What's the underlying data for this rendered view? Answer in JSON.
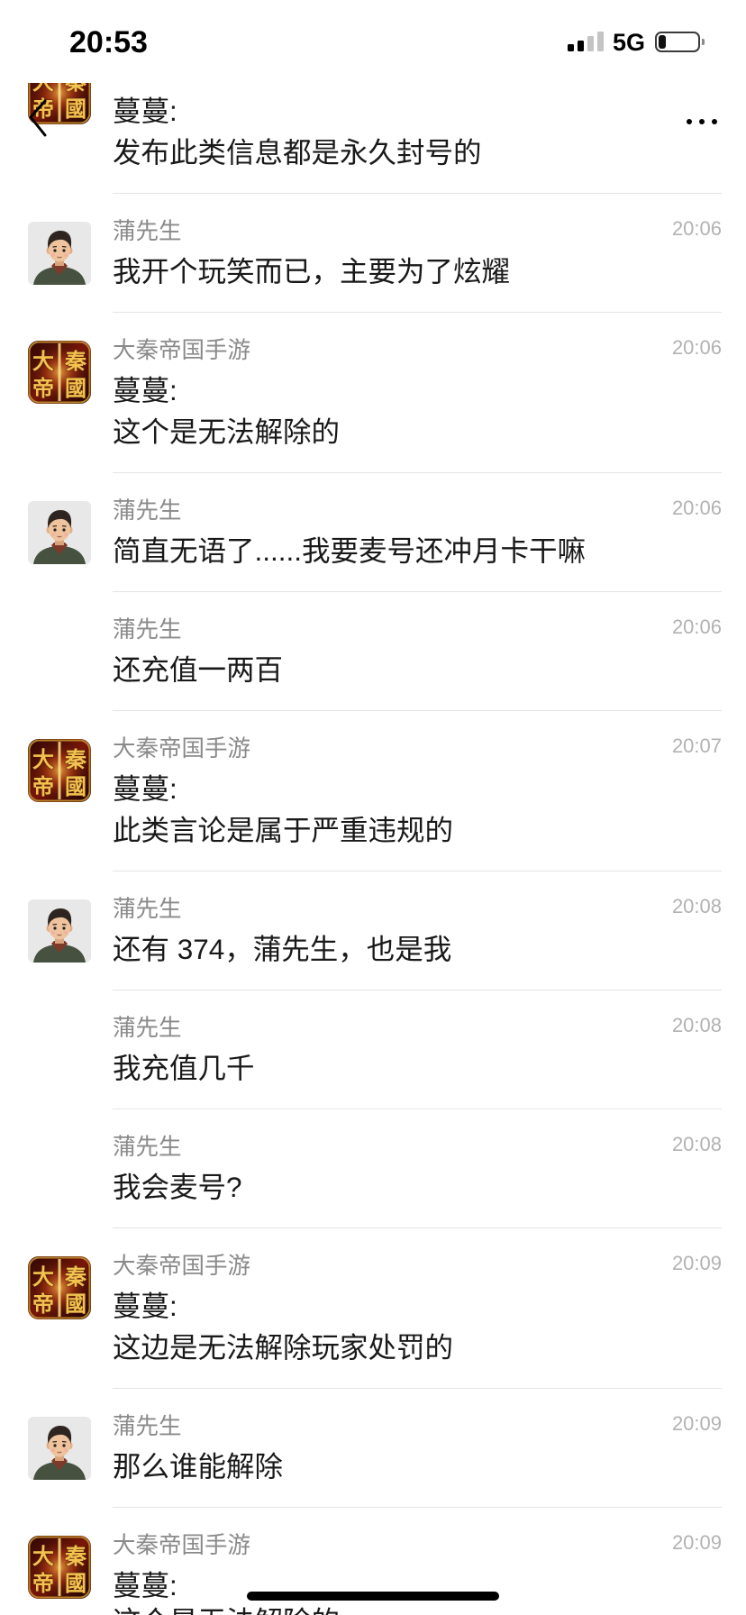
{
  "status_bar": {
    "time": "20:53",
    "network": "5G",
    "signal_bars_filled": 2,
    "signal_bars_total": 4,
    "battery_level": 0.2
  },
  "nav": {
    "back_icon": "chevron-left-icon",
    "more_icon": "more-dots-icon"
  },
  "game_avatar": {
    "logo_chars": [
      "大",
      "秦",
      "帝",
      "國"
    ]
  },
  "messages": [
    {
      "avatar": "game-app-icon",
      "lines": [
        "蔓蔓:",
        "发布此类信息都是永久封号的"
      ]
    },
    {
      "sender": "蒲先生",
      "time": "20:06",
      "avatar": "user-cartoon-icon",
      "lines": [
        "我开个玩笑而已，主要为了炫耀"
      ]
    },
    {
      "sender": "大秦帝国手游",
      "time": "20:06",
      "avatar": "game-app-icon",
      "lines": [
        "蔓蔓:",
        "这个是无法解除的"
      ]
    },
    {
      "sender": "蒲先生",
      "time": "20:06",
      "avatar": "user-cartoon-icon",
      "lines": [
        "简直无语了......我要麦号还冲月卡干嘛"
      ]
    },
    {
      "sender": "蒲先生",
      "time": "20:06",
      "lines": [
        "还充值一两百"
      ]
    },
    {
      "sender": "大秦帝国手游",
      "time": "20:07",
      "avatar": "game-app-icon",
      "lines": [
        "蔓蔓:",
        "此类言论是属于严重违规的"
      ]
    },
    {
      "sender": "蒲先生",
      "time": "20:08",
      "avatar": "user-cartoon-icon",
      "lines": [
        "还有 374，蒲先生，也是我"
      ]
    },
    {
      "sender": "蒲先生",
      "time": "20:08",
      "lines": [
        "我充值几千"
      ]
    },
    {
      "sender": "蒲先生",
      "time": "20:08",
      "lines": [
        "我会麦号?"
      ]
    },
    {
      "sender": "大秦帝国手游",
      "time": "20:09",
      "avatar": "game-app-icon",
      "lines": [
        "蔓蔓:",
        "这边是无法解除玩家处罚的"
      ]
    },
    {
      "sender": "蒲先生",
      "time": "20:09",
      "avatar": "user-cartoon-icon",
      "lines": [
        "那么谁能解除"
      ]
    },
    {
      "sender": "大秦帝国手游",
      "time": "20:09",
      "avatar": "game-app-icon",
      "lines": [
        "蔓蔓:",
        "这个是无法解除的"
      ]
    }
  ],
  "colors": {
    "background": "#ffffff",
    "message_text": "#191919",
    "sender_text": "#8a8a8a",
    "time_text": "#b2b2b2",
    "divider": "#e5e5e5"
  }
}
